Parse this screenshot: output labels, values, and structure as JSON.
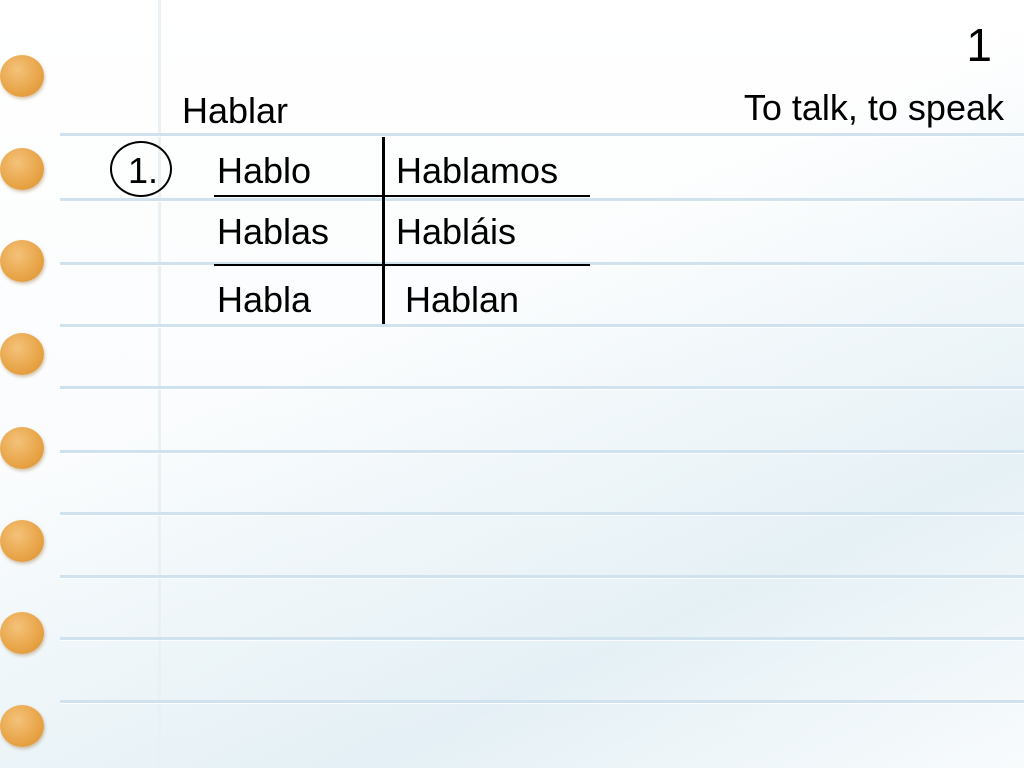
{
  "page_number": "1",
  "verb": {
    "infinitive": "Hablar",
    "translation": "To talk, to speak"
  },
  "item_number": "1.",
  "conjugations": {
    "singular": [
      "Hablo",
      "Hablas",
      "Habla"
    ],
    "plural": [
      "Hablamos",
      "Habláis",
      "Hablan"
    ]
  },
  "colors": {
    "ring_hole": "#e8a447",
    "ruled_line": "#cfe2ee"
  },
  "icons": {
    "binder_ring": "binder-hole-icon"
  }
}
